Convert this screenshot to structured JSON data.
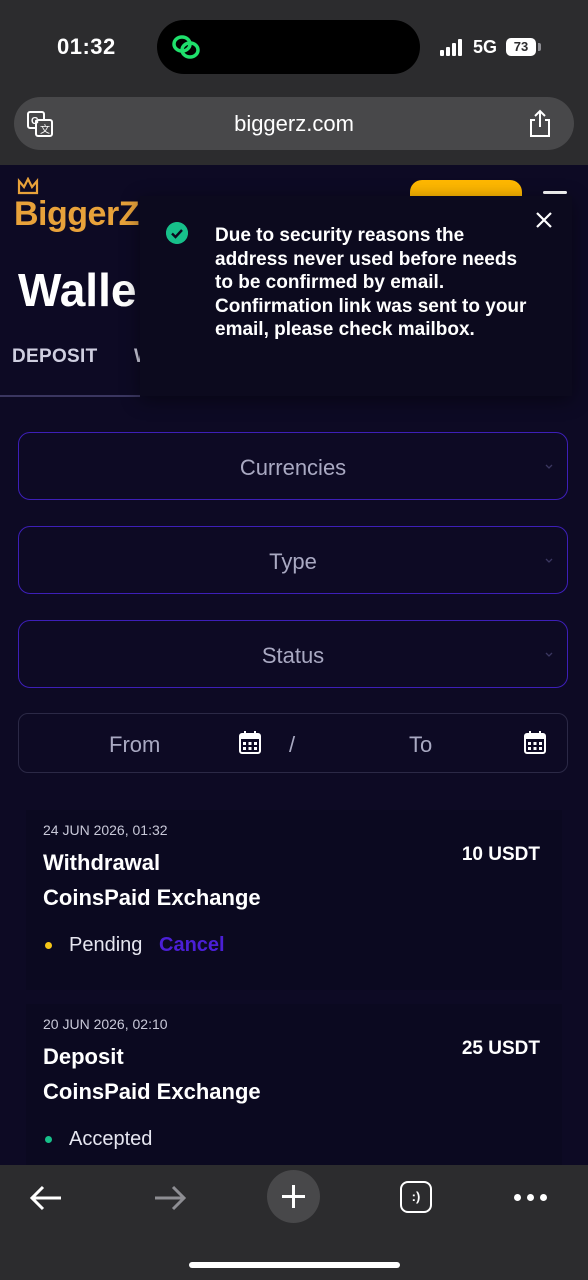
{
  "status_bar": {
    "time": "01:32",
    "network": "5G",
    "battery": "73"
  },
  "browser": {
    "url": "biggerz.com"
  },
  "site": {
    "logo_text": "BiggerZ",
    "page_title": "Walle",
    "tabs": [
      "DEPOSIT",
      "W"
    ]
  },
  "filters": {
    "currencies": "Currencies",
    "type": "Type",
    "status": "Status",
    "date_from": "From",
    "date_separator": "/",
    "date_to": "To"
  },
  "transactions": [
    {
      "date": "24 JUN 2026, 01:32",
      "type": "Withdrawal",
      "provider": "CoinsPaid Exchange",
      "amount": "10 USDT",
      "status": "Pending",
      "status_color": "#f5c518",
      "action": "Cancel"
    },
    {
      "date": "20 JUN 2026, 02:10",
      "type": "Deposit",
      "provider": "CoinsPaid Exchange",
      "amount": "25 USDT",
      "status": "Accepted",
      "status_color": "#17c08a"
    }
  ],
  "toast": {
    "message": "Due to security reasons the address never used before needs to be confirmed by email. Confirmation link was sent to your email, please check mailbox."
  },
  "bottom_bar": {
    "tabs_label": ":)"
  },
  "colors": {
    "accent_purple": "#3d1fb8",
    "cancel_purple": "#4b1fd6",
    "logo_orange": "#e8a23a",
    "success_green": "#17c08a"
  }
}
